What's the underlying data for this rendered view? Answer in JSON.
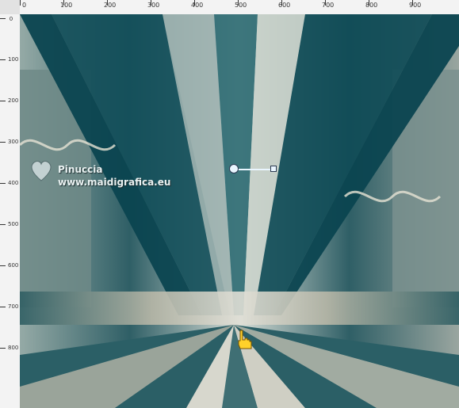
{
  "ruler_top_labels": [
    "0",
    "100",
    "200",
    "300",
    "400",
    "500",
    "600",
    "700",
    "800",
    "900"
  ],
  "ruler_left_labels": [
    "0",
    "100",
    "200",
    "300",
    "400",
    "500",
    "600",
    "700",
    "800"
  ],
  "watermark": {
    "line1": "Pinuccia",
    "line2": "www.maidigrafica.eu"
  },
  "icons": [
    "heart-logo-icon",
    "pointing-hand-cursor-icon",
    "transform-handle-icon"
  ],
  "colors": {
    "accent": "#2e6d75",
    "frame": "#c9d6e6",
    "ruler": "#f3f3f3"
  }
}
